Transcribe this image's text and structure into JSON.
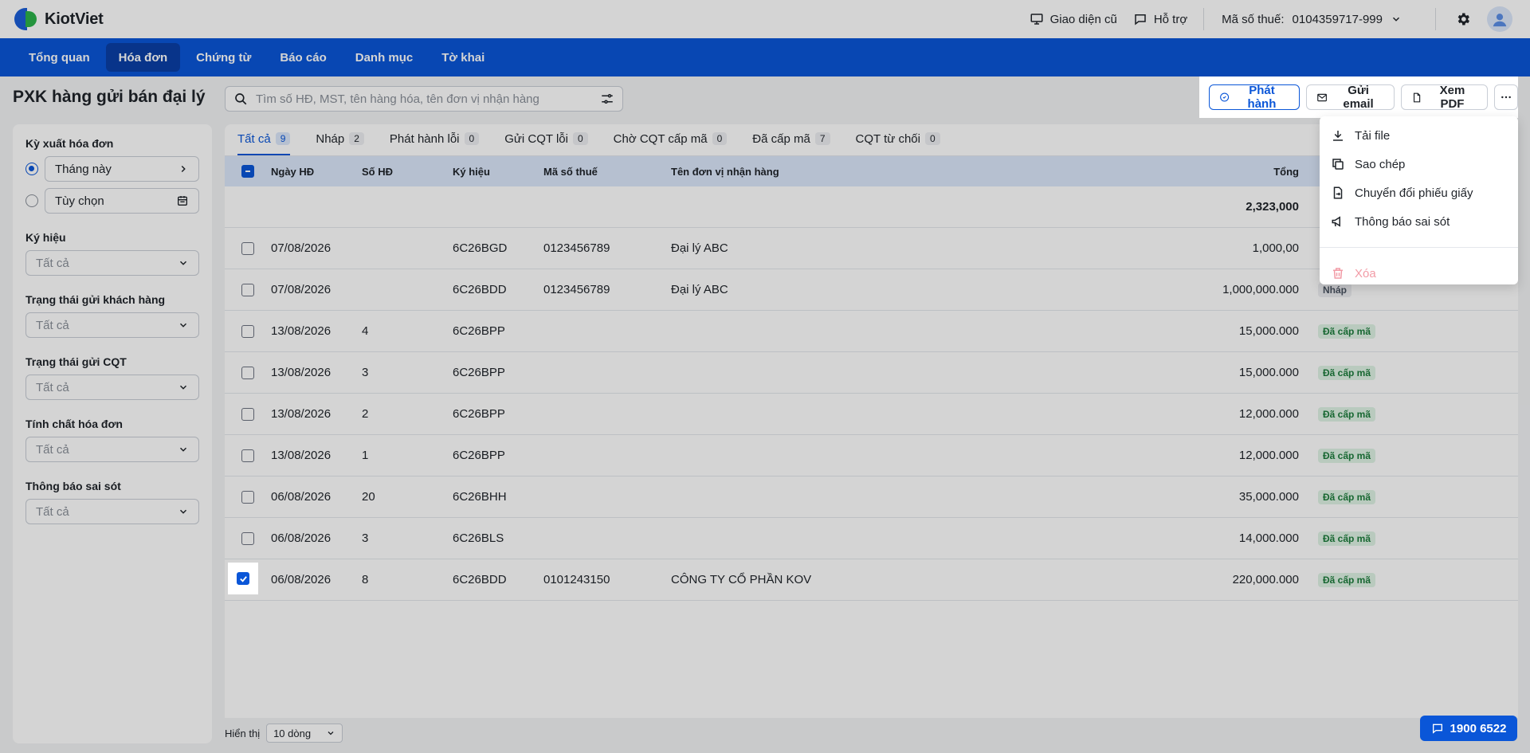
{
  "header": {
    "brand": "KiotViet",
    "old_ui_label": "Giao diện cũ",
    "support_label": "Hỗ trợ",
    "tax_code_label": "Mã số thuế:",
    "tax_code_value": "0104359717-999"
  },
  "nav": {
    "items": [
      "Tổng quan",
      "Hóa đơn",
      "Chứng từ",
      "Báo cáo",
      "Danh mục",
      "Tờ khai"
    ],
    "active": "Hóa đơn"
  },
  "page": {
    "title": "PXK hàng gửi bán đại lý",
    "search_placeholder": "Tìm số HĐ, MST, tên hàng hóa, tên đơn vị nhận hàng"
  },
  "actions": {
    "issue": "Phát hành",
    "send_email": "Gửi email",
    "view_pdf": "Xem PDF"
  },
  "menu": {
    "items": [
      "Tải file",
      "Sao chép",
      "Chuyển đổi phiếu giấy",
      "Thông báo sai sót"
    ],
    "delete": "Xóa"
  },
  "filters": {
    "period_label": "Kỳ xuất hóa đơn",
    "period_this_month": "Tháng này",
    "period_custom": "Tùy chọn",
    "symbol_label": "Ký hiệu",
    "customer_status_label": "Trạng thái gửi khách hàng",
    "cqt_status_label": "Trạng thái gửi CQT",
    "invoice_nature_label": "Tính chất hóa đơn",
    "error_notice_label": "Thông báo sai sót",
    "all": "Tất cả"
  },
  "tabs": [
    {
      "label": "Tất cả",
      "count": "9"
    },
    {
      "label": "Nháp",
      "count": "2"
    },
    {
      "label": "Phát hành lỗi",
      "count": "0"
    },
    {
      "label": "Gửi CQT lỗi",
      "count": "0"
    },
    {
      "label": "Chờ CQT cấp mã",
      "count": "0"
    },
    {
      "label": "Đã cấp mã",
      "count": "7"
    },
    {
      "label": "CQT từ chối",
      "count": "0"
    }
  ],
  "table": {
    "columns": [
      "Ngày HĐ",
      "Số HĐ",
      "Ký hiệu",
      "Mã số thuế",
      "Tên đơn vị nhận hàng",
      "Tổng"
    ],
    "sum_total": "2,323,000",
    "rows": [
      {
        "date": "07/08/2026",
        "no": "",
        "symbol": "6C26BGD",
        "tax": "0123456789",
        "name": "Đại lý ABC",
        "total": "1,000,00",
        "status": "",
        "checked": false
      },
      {
        "date": "07/08/2026",
        "no": "",
        "symbol": "6C26BDD",
        "tax": "0123456789",
        "name": "Đại lý ABC",
        "total": "1,000,000.000",
        "status": "Nháp",
        "checked": false
      },
      {
        "date": "13/08/2026",
        "no": "4",
        "symbol": "6C26BPP",
        "tax": "",
        "name": "",
        "total": "15,000.000",
        "status": "Đã cấp mã",
        "checked": false
      },
      {
        "date": "13/08/2026",
        "no": "3",
        "symbol": "6C26BPP",
        "tax": "",
        "name": "",
        "total": "15,000.000",
        "status": "Đã cấp mã",
        "checked": false
      },
      {
        "date": "13/08/2026",
        "no": "2",
        "symbol": "6C26BPP",
        "tax": "",
        "name": "",
        "total": "12,000.000",
        "status": "Đã cấp mã",
        "checked": false
      },
      {
        "date": "13/08/2026",
        "no": "1",
        "symbol": "6C26BPP",
        "tax": "",
        "name": "",
        "total": "12,000.000",
        "status": "Đã cấp mã",
        "checked": false
      },
      {
        "date": "06/08/2026",
        "no": "20",
        "symbol": "6C26BHH",
        "tax": "",
        "name": "",
        "total": "35,000.000",
        "status": "Đã cấp mã",
        "checked": false
      },
      {
        "date": "06/08/2026",
        "no": "3",
        "symbol": "6C26BLS",
        "tax": "",
        "name": "",
        "total": "14,000.000",
        "status": "Đã cấp mã",
        "checked": false
      },
      {
        "date": "06/08/2026",
        "no": "8",
        "symbol": "6C26BDD",
        "tax": "0101243150",
        "name": "CÔNG TY CỔ PHẦN KOV",
        "total": "220,000.000",
        "status": "Đã cấp mã",
        "checked": true
      }
    ]
  },
  "footer": {
    "show_label": "Hiển thị",
    "page_size": "10 dòng"
  },
  "hotline": "1900 6522",
  "colors": {
    "primary": "#0a56d8",
    "nav_active": "#0a3fa6",
    "table_header": "#dbe7fb",
    "badge_ok_bg": "#dff3e5",
    "badge_ok_fg": "#1c7c3c",
    "danger_disabled": "#f29ba6"
  }
}
